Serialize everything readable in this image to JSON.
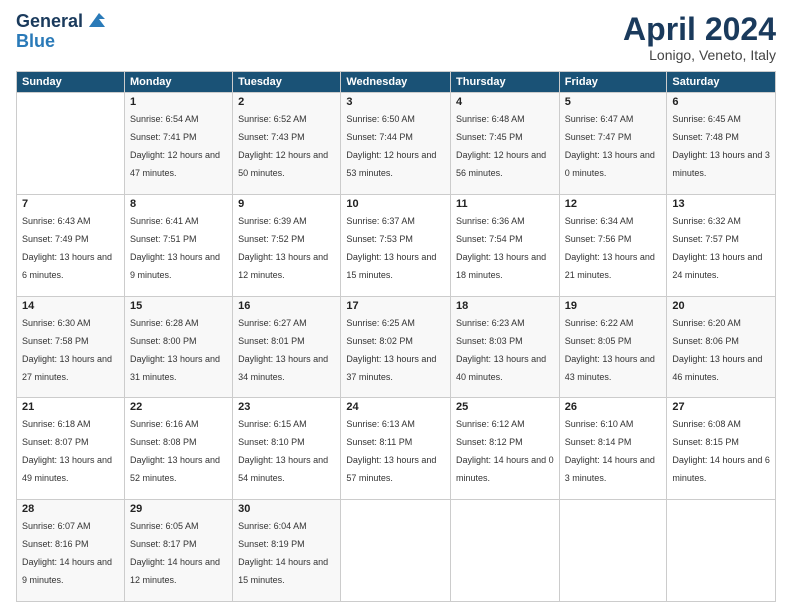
{
  "header": {
    "logo_line1": "General",
    "logo_line2": "Blue",
    "month_title": "April 2024",
    "subtitle": "Lonigo, Veneto, Italy"
  },
  "calendar": {
    "days_of_week": [
      "Sunday",
      "Monday",
      "Tuesday",
      "Wednesday",
      "Thursday",
      "Friday",
      "Saturday"
    ],
    "weeks": [
      [
        {
          "day": "",
          "sunrise": "",
          "sunset": "",
          "daylight": ""
        },
        {
          "day": "1",
          "sunrise": "Sunrise: 6:54 AM",
          "sunset": "Sunset: 7:41 PM",
          "daylight": "Daylight: 12 hours and 47 minutes."
        },
        {
          "day": "2",
          "sunrise": "Sunrise: 6:52 AM",
          "sunset": "Sunset: 7:43 PM",
          "daylight": "Daylight: 12 hours and 50 minutes."
        },
        {
          "day": "3",
          "sunrise": "Sunrise: 6:50 AM",
          "sunset": "Sunset: 7:44 PM",
          "daylight": "Daylight: 12 hours and 53 minutes."
        },
        {
          "day": "4",
          "sunrise": "Sunrise: 6:48 AM",
          "sunset": "Sunset: 7:45 PM",
          "daylight": "Daylight: 12 hours and 56 minutes."
        },
        {
          "day": "5",
          "sunrise": "Sunrise: 6:47 AM",
          "sunset": "Sunset: 7:47 PM",
          "daylight": "Daylight: 13 hours and 0 minutes."
        },
        {
          "day": "6",
          "sunrise": "Sunrise: 6:45 AM",
          "sunset": "Sunset: 7:48 PM",
          "daylight": "Daylight: 13 hours and 3 minutes."
        }
      ],
      [
        {
          "day": "7",
          "sunrise": "Sunrise: 6:43 AM",
          "sunset": "Sunset: 7:49 PM",
          "daylight": "Daylight: 13 hours and 6 minutes."
        },
        {
          "day": "8",
          "sunrise": "Sunrise: 6:41 AM",
          "sunset": "Sunset: 7:51 PM",
          "daylight": "Daylight: 13 hours and 9 minutes."
        },
        {
          "day": "9",
          "sunrise": "Sunrise: 6:39 AM",
          "sunset": "Sunset: 7:52 PM",
          "daylight": "Daylight: 13 hours and 12 minutes."
        },
        {
          "day": "10",
          "sunrise": "Sunrise: 6:37 AM",
          "sunset": "Sunset: 7:53 PM",
          "daylight": "Daylight: 13 hours and 15 minutes."
        },
        {
          "day": "11",
          "sunrise": "Sunrise: 6:36 AM",
          "sunset": "Sunset: 7:54 PM",
          "daylight": "Daylight: 13 hours and 18 minutes."
        },
        {
          "day": "12",
          "sunrise": "Sunrise: 6:34 AM",
          "sunset": "Sunset: 7:56 PM",
          "daylight": "Daylight: 13 hours and 21 minutes."
        },
        {
          "day": "13",
          "sunrise": "Sunrise: 6:32 AM",
          "sunset": "Sunset: 7:57 PM",
          "daylight": "Daylight: 13 hours and 24 minutes."
        }
      ],
      [
        {
          "day": "14",
          "sunrise": "Sunrise: 6:30 AM",
          "sunset": "Sunset: 7:58 PM",
          "daylight": "Daylight: 13 hours and 27 minutes."
        },
        {
          "day": "15",
          "sunrise": "Sunrise: 6:28 AM",
          "sunset": "Sunset: 8:00 PM",
          "daylight": "Daylight: 13 hours and 31 minutes."
        },
        {
          "day": "16",
          "sunrise": "Sunrise: 6:27 AM",
          "sunset": "Sunset: 8:01 PM",
          "daylight": "Daylight: 13 hours and 34 minutes."
        },
        {
          "day": "17",
          "sunrise": "Sunrise: 6:25 AM",
          "sunset": "Sunset: 8:02 PM",
          "daylight": "Daylight: 13 hours and 37 minutes."
        },
        {
          "day": "18",
          "sunrise": "Sunrise: 6:23 AM",
          "sunset": "Sunset: 8:03 PM",
          "daylight": "Daylight: 13 hours and 40 minutes."
        },
        {
          "day": "19",
          "sunrise": "Sunrise: 6:22 AM",
          "sunset": "Sunset: 8:05 PM",
          "daylight": "Daylight: 13 hours and 43 minutes."
        },
        {
          "day": "20",
          "sunrise": "Sunrise: 6:20 AM",
          "sunset": "Sunset: 8:06 PM",
          "daylight": "Daylight: 13 hours and 46 minutes."
        }
      ],
      [
        {
          "day": "21",
          "sunrise": "Sunrise: 6:18 AM",
          "sunset": "Sunset: 8:07 PM",
          "daylight": "Daylight: 13 hours and 49 minutes."
        },
        {
          "day": "22",
          "sunrise": "Sunrise: 6:16 AM",
          "sunset": "Sunset: 8:08 PM",
          "daylight": "Daylight: 13 hours and 52 minutes."
        },
        {
          "day": "23",
          "sunrise": "Sunrise: 6:15 AM",
          "sunset": "Sunset: 8:10 PM",
          "daylight": "Daylight: 13 hours and 54 minutes."
        },
        {
          "day": "24",
          "sunrise": "Sunrise: 6:13 AM",
          "sunset": "Sunset: 8:11 PM",
          "daylight": "Daylight: 13 hours and 57 minutes."
        },
        {
          "day": "25",
          "sunrise": "Sunrise: 6:12 AM",
          "sunset": "Sunset: 8:12 PM",
          "daylight": "Daylight: 14 hours and 0 minutes."
        },
        {
          "day": "26",
          "sunrise": "Sunrise: 6:10 AM",
          "sunset": "Sunset: 8:14 PM",
          "daylight": "Daylight: 14 hours and 3 minutes."
        },
        {
          "day": "27",
          "sunrise": "Sunrise: 6:08 AM",
          "sunset": "Sunset: 8:15 PM",
          "daylight": "Daylight: 14 hours and 6 minutes."
        }
      ],
      [
        {
          "day": "28",
          "sunrise": "Sunrise: 6:07 AM",
          "sunset": "Sunset: 8:16 PM",
          "daylight": "Daylight: 14 hours and 9 minutes."
        },
        {
          "day": "29",
          "sunrise": "Sunrise: 6:05 AM",
          "sunset": "Sunset: 8:17 PM",
          "daylight": "Daylight: 14 hours and 12 minutes."
        },
        {
          "day": "30",
          "sunrise": "Sunrise: 6:04 AM",
          "sunset": "Sunset: 8:19 PM",
          "daylight": "Daylight: 14 hours and 15 minutes."
        },
        {
          "day": "",
          "sunrise": "",
          "sunset": "",
          "daylight": ""
        },
        {
          "day": "",
          "sunrise": "",
          "sunset": "",
          "daylight": ""
        },
        {
          "day": "",
          "sunrise": "",
          "sunset": "",
          "daylight": ""
        },
        {
          "day": "",
          "sunrise": "",
          "sunset": "",
          "daylight": ""
        }
      ]
    ]
  }
}
